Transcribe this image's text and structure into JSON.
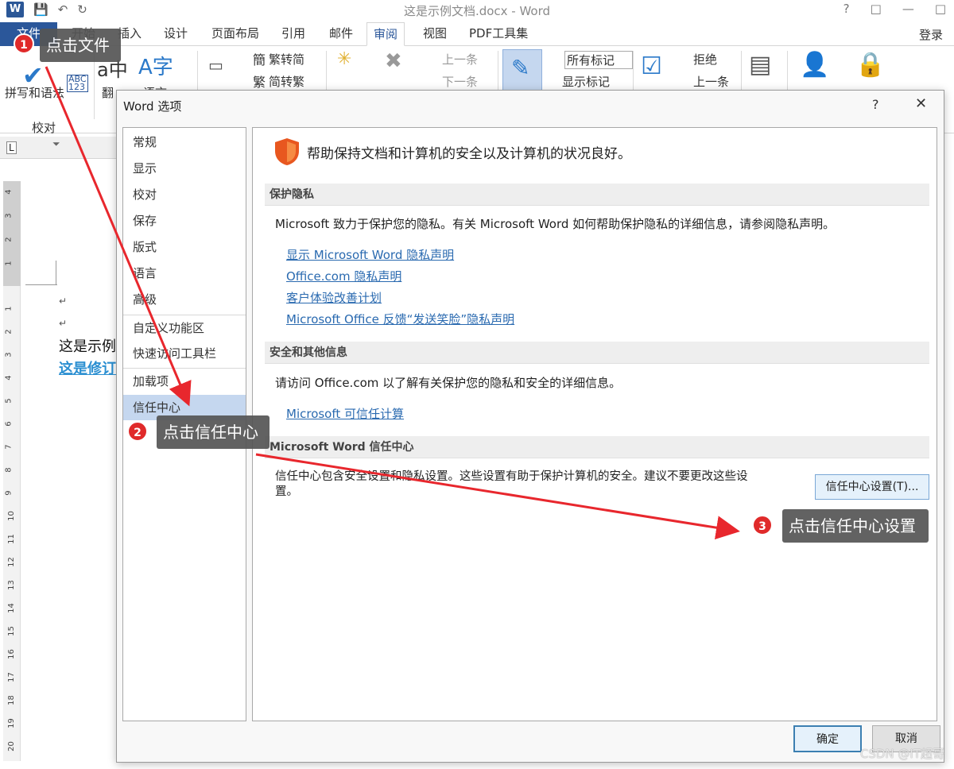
{
  "window": {
    "title": "这是示例文档.docx - Word",
    "help": "?",
    "restore": "□",
    "minimize": "—",
    "close": "✕",
    "word_logo": "W"
  },
  "tabs": [
    "文件",
    "开始",
    "插入",
    "设计",
    "页面布局",
    "引用",
    "邮件",
    "审阅",
    "视图",
    "PDF工具集"
  ],
  "active_tab": "审阅",
  "signin": "登录",
  "ribbon": {
    "spell": "拼写和语法",
    "proof_group": "校对",
    "translate": "翻",
    "lang": "语言",
    "trad_simp": "繁转简",
    "simp_trad": "简转繁",
    "new_comment": "新建批注",
    "delete": "删除",
    "prev1": "上一条",
    "next1": "下一条",
    "track": "修订",
    "all_markup": "所有标记",
    "show_markup": "显示标记",
    "accept": "接受",
    "reject": "拒绝",
    "prev2": "上一条",
    "compare": "比较",
    "block_authors": "阻止作者",
    "restrict": "限制编辑",
    "abc": "ABC",
    "n123": "123"
  },
  "document": {
    "line1": "这是示例",
    "line2": "这是修订",
    "para": "↵"
  },
  "ruler_numbers": [
    "4",
    "3",
    "2",
    "1",
    "1",
    "2",
    "3",
    "4",
    "5",
    "6",
    "7",
    "8",
    "9",
    "10",
    "11",
    "12",
    "13",
    "14",
    "15",
    "16",
    "17",
    "18",
    "19",
    "20"
  ],
  "dialog": {
    "title": "Word 选项",
    "help": "?",
    "close": "✕",
    "nav": [
      "常规",
      "显示",
      "校对",
      "保存",
      "版式",
      "语言",
      "高级",
      "自定义功能区",
      "快速访问工具栏",
      "加载项",
      "信任中心"
    ],
    "selected_nav": "信任中心",
    "headline": "帮助保持文档和计算机的安全以及计算机的状况良好。",
    "privacy": {
      "header": "保护隐私",
      "text": "Microsoft 致力于保护您的隐私。有关 Microsoft Word 如何帮助保护隐私的详细信息，请参阅隐私声明。",
      "links": [
        "显示 Microsoft Word 隐私声明",
        "Office.com 隐私声明",
        "客户体验改善计划",
        "Microsoft Office 反馈“发送笑脸”隐私声明"
      ]
    },
    "security": {
      "header": "安全和其他信息",
      "text": "请访问 Office.com 以了解有关保护您的隐私和安全的详细信息。",
      "link": "Microsoft 可信任计算"
    },
    "trust": {
      "header": "Microsoft Word 信任中心",
      "desc": "信任中心包含安全设置和隐私设置。这些设置有助于保护计算机的安全。建议不要更改这些设置。",
      "button": "信任中心设置(T)..."
    },
    "ok": "确定",
    "cancel": "取消"
  },
  "annotations": {
    "step1": {
      "num": "1",
      "text": "点击文件"
    },
    "step2": {
      "num": "2",
      "text": "点击信任中心"
    },
    "step3": {
      "num": "3",
      "text": "点击信任中心设置"
    }
  },
  "watermark": "CSDN @IT超哥",
  "colors": {
    "accent": "#2b579a",
    "arrow": "#e8272d",
    "link": "#2a6ab0",
    "selected": "#c5d7ef"
  }
}
